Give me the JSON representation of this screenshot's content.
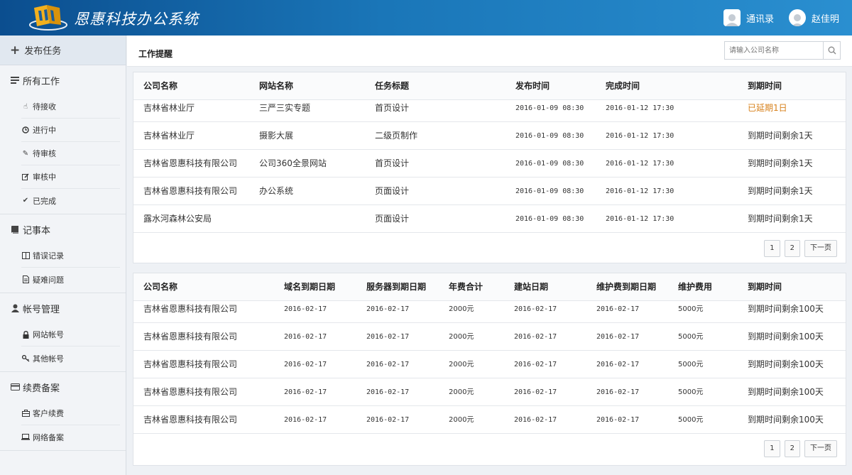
{
  "header": {
    "app_title": "恩惠科技办公系统",
    "contacts_label": "通讯录",
    "user_name": "赵佳明"
  },
  "sidebar": {
    "publish_label": "发布任务",
    "groups": [
      {
        "title": "所有工作",
        "icon": "list-icon",
        "items": [
          {
            "label": "待接收",
            "icon": "hand-pointer-icon"
          },
          {
            "label": "进行中",
            "icon": "clock-icon"
          },
          {
            "label": "待审核",
            "icon": "pencil-icon"
          },
          {
            "label": "审核中",
            "icon": "edit-icon"
          },
          {
            "label": "已完成",
            "icon": "check-icon"
          }
        ]
      },
      {
        "title": "记事本",
        "icon": "book-icon",
        "items": [
          {
            "label": "错误记录",
            "icon": "columns-icon"
          },
          {
            "label": "疑难问题",
            "icon": "document-icon"
          }
        ]
      },
      {
        "title": "帐号管理",
        "icon": "user-icon",
        "items": [
          {
            "label": "网站帐号",
            "icon": "lock-icon"
          },
          {
            "label": "其他帐号",
            "icon": "key-icon"
          }
        ]
      },
      {
        "title": "续费备案",
        "icon": "credit-card-icon",
        "items": [
          {
            "label": "客户续费",
            "icon": "briefcase-icon"
          },
          {
            "label": "网络备案",
            "icon": "laptop-icon"
          }
        ]
      }
    ]
  },
  "main": {
    "page_title": "工作提醒",
    "search_placeholder": "请输入公司名称"
  },
  "tasks_table": {
    "columns": [
      "公司名称",
      "网站名称",
      "任务标题",
      "发布时间",
      "完成时间",
      "到期时间"
    ],
    "rows": [
      [
        "吉林省林业厅",
        "三严三实专题",
        "首页设计",
        "2016-01-09 08:30",
        "2016-01-12 17:30",
        "已延期1日"
      ],
      [
        "吉林省林业厅",
        "摄影大展",
        "二级页制作",
        "2016-01-09 08:30",
        "2016-01-12 17:30",
        "到期时间剩余1天"
      ],
      [
        "吉林省恩惠科技有限公司",
        "公司360全景网站",
        "首页设计",
        "2016-01-09 08:30",
        "2016-01-12 17:30",
        "到期时间剩余1天"
      ],
      [
        "吉林省恩惠科技有限公司",
        "办公系统",
        "页面设计",
        "2016-01-09 08:30",
        "2016-01-12 17:30",
        "到期时间剩余1天"
      ],
      [
        "露水河森林公安局",
        "",
        "页面设计",
        "2016-01-09 08:30",
        "2016-01-12 17:30",
        "到期时间剩余1天"
      ]
    ],
    "pager": [
      "1",
      "2",
      "下一页"
    ]
  },
  "renewal_table": {
    "columns": [
      "公司名称",
      "域名到期日期",
      "服务器到期日期",
      "年费合计",
      "建站日期",
      "维护费到期日期",
      "维护费用",
      "到期时间"
    ],
    "rows": [
      [
        "吉林省恩惠科技有限公司",
        "2016-02-17",
        "2016-02-17",
        "2000元",
        "2016-02-17",
        "2016-02-17",
        "5000元",
        "到期时间剩余100天"
      ],
      [
        "吉林省恩惠科技有限公司",
        "2016-02-17",
        "2016-02-17",
        "2000元",
        "2016-02-17",
        "2016-02-17",
        "5000元",
        "到期时间剩余100天"
      ],
      [
        "吉林省恩惠科技有限公司",
        "2016-02-17",
        "2016-02-17",
        "2000元",
        "2016-02-17",
        "2016-02-17",
        "5000元",
        "到期时间剩余100天"
      ],
      [
        "吉林省恩惠科技有限公司",
        "2016-02-17",
        "2016-02-17",
        "2000元",
        "2016-02-17",
        "2016-02-17",
        "5000元",
        "到期时间剩余100天"
      ],
      [
        "吉林省恩惠科技有限公司",
        "2016-02-17",
        "2016-02-17",
        "2000元",
        "2016-02-17",
        "2016-02-17",
        "5000元",
        "到期时间剩余100天"
      ]
    ],
    "pager": [
      "1",
      "2",
      "下一页"
    ]
  },
  "colors": {
    "header_start": "#0b4e8f",
    "header_end": "#2a8fd0",
    "overdue": "#d7801a"
  }
}
